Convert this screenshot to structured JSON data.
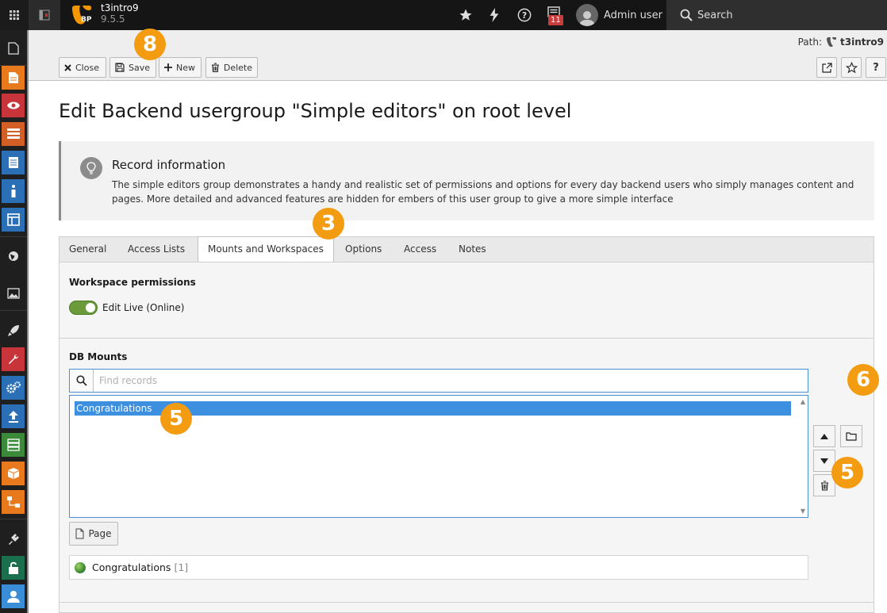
{
  "topbar": {
    "site_name": "t3intro9",
    "site_version": "9.5.5",
    "site_logo_text": "BP",
    "notification_count": "11",
    "user_name": "Admin user",
    "search_label": "Search"
  },
  "sidebar": {
    "items": [
      {
        "icon": "page-icon",
        "color": "#1f1f1f"
      },
      {
        "icon": "page-module-icon",
        "color": "#e8791c"
      },
      {
        "icon": "view-eye-icon",
        "color": "#c7343a"
      },
      {
        "icon": "list-icon",
        "color": "#d35f26"
      },
      {
        "icon": "form-icon",
        "color": "#2b6fb6"
      },
      {
        "icon": "info-icon",
        "color": "#2b6fb6"
      },
      {
        "icon": "template-icon",
        "color": "#2b6fb6"
      },
      {
        "icon": "globe-icon",
        "color": "#1f1f1f"
      },
      {
        "icon": "image-icon",
        "color": "#1f1f1f"
      },
      {
        "icon": "rocket-icon",
        "color": "#1f1f1f"
      },
      {
        "icon": "wrench-icon",
        "color": "#c7343a"
      },
      {
        "icon": "cogs-icon",
        "color": "#2b6fb6"
      },
      {
        "icon": "upload-icon",
        "color": "#2b6fb6"
      },
      {
        "icon": "server-icon",
        "color": "#3a8a3a"
      },
      {
        "icon": "box-icon",
        "color": "#e8791c"
      },
      {
        "icon": "sitemap-icon",
        "color": "#e8791c"
      },
      {
        "icon": "plug-icon",
        "color": "#1f1f1f"
      },
      {
        "icon": "unlock-icon",
        "color": "#1a6f4e"
      },
      {
        "icon": "user-icon",
        "color": "#3a8ed8"
      }
    ]
  },
  "doc_header": {
    "path_label": "Path:",
    "path_value": "t3intro9",
    "buttons": {
      "close": "Close",
      "save": "Save",
      "new": "New",
      "delete": "Delete"
    }
  },
  "page": {
    "title": "Edit Backend usergroup \"Simple editors\" on root level"
  },
  "record_info": {
    "title": "Record information",
    "text": "The simple editors group demonstrates a handy and realistic set of permissions and options for every day backend users who simply manages content and pages. More detailed and advanced features are hidden for embers of this user group to give a more simple interface"
  },
  "tabs": [
    {
      "label": "General",
      "active": false
    },
    {
      "label": "Access Lists",
      "active": false
    },
    {
      "label": "Mounts and Workspaces",
      "active": true
    },
    {
      "label": "Options",
      "active": false
    },
    {
      "label": "Access",
      "active": false
    },
    {
      "label": "Notes",
      "active": false
    }
  ],
  "workspace": {
    "title": "Workspace permissions",
    "toggle_label": "Edit Live (Online)",
    "toggle_on": true
  },
  "db_mounts": {
    "title": "DB Mounts",
    "find_placeholder": "Find records",
    "selected_items": [
      "Congratulations"
    ],
    "page_button": "Page",
    "record_name": "Congratulations",
    "record_count": "[1]"
  },
  "markers": {
    "save": "8",
    "tab": "3",
    "list": "5",
    "browse": "6",
    "remove": "5"
  },
  "colors": {
    "accent": "#3d8fe0",
    "marker": "#f39c12",
    "toggle_on": "#6a9a3a"
  }
}
